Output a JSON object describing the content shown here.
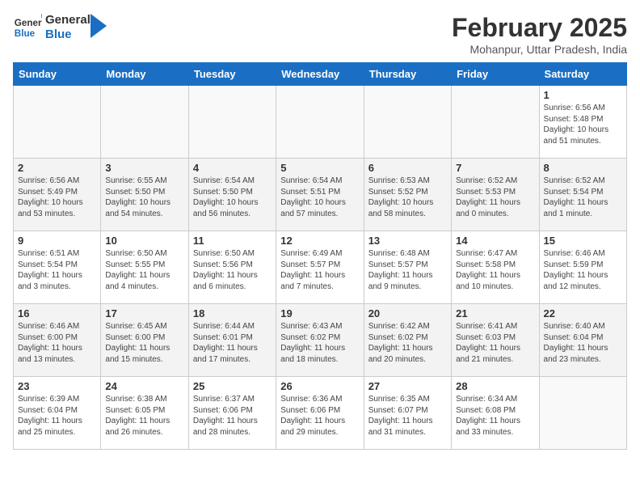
{
  "app": {
    "name": "GeneralBlue",
    "logo_text_general": "General",
    "logo_text_blue": "Blue"
  },
  "title": "February 2025",
  "location": "Mohanpur, Uttar Pradesh, India",
  "weekdays": [
    "Sunday",
    "Monday",
    "Tuesday",
    "Wednesday",
    "Thursday",
    "Friday",
    "Saturday"
  ],
  "weeks": [
    [
      {
        "day": "",
        "info": ""
      },
      {
        "day": "",
        "info": ""
      },
      {
        "day": "",
        "info": ""
      },
      {
        "day": "",
        "info": ""
      },
      {
        "day": "",
        "info": ""
      },
      {
        "day": "",
        "info": ""
      },
      {
        "day": "1",
        "info": "Sunrise: 6:56 AM\nSunset: 5:48 PM\nDaylight: 10 hours\nand 51 minutes."
      }
    ],
    [
      {
        "day": "2",
        "info": "Sunrise: 6:56 AM\nSunset: 5:49 PM\nDaylight: 10 hours\nand 53 minutes."
      },
      {
        "day": "3",
        "info": "Sunrise: 6:55 AM\nSunset: 5:50 PM\nDaylight: 10 hours\nand 54 minutes."
      },
      {
        "day": "4",
        "info": "Sunrise: 6:54 AM\nSunset: 5:50 PM\nDaylight: 10 hours\nand 56 minutes."
      },
      {
        "day": "5",
        "info": "Sunrise: 6:54 AM\nSunset: 5:51 PM\nDaylight: 10 hours\nand 57 minutes."
      },
      {
        "day": "6",
        "info": "Sunrise: 6:53 AM\nSunset: 5:52 PM\nDaylight: 10 hours\nand 58 minutes."
      },
      {
        "day": "7",
        "info": "Sunrise: 6:52 AM\nSunset: 5:53 PM\nDaylight: 11 hours\nand 0 minutes."
      },
      {
        "day": "8",
        "info": "Sunrise: 6:52 AM\nSunset: 5:54 PM\nDaylight: 11 hours\nand 1 minute."
      }
    ],
    [
      {
        "day": "9",
        "info": "Sunrise: 6:51 AM\nSunset: 5:54 PM\nDaylight: 11 hours\nand 3 minutes."
      },
      {
        "day": "10",
        "info": "Sunrise: 6:50 AM\nSunset: 5:55 PM\nDaylight: 11 hours\nand 4 minutes."
      },
      {
        "day": "11",
        "info": "Sunrise: 6:50 AM\nSunset: 5:56 PM\nDaylight: 11 hours\nand 6 minutes."
      },
      {
        "day": "12",
        "info": "Sunrise: 6:49 AM\nSunset: 5:57 PM\nDaylight: 11 hours\nand 7 minutes."
      },
      {
        "day": "13",
        "info": "Sunrise: 6:48 AM\nSunset: 5:57 PM\nDaylight: 11 hours\nand 9 minutes."
      },
      {
        "day": "14",
        "info": "Sunrise: 6:47 AM\nSunset: 5:58 PM\nDaylight: 11 hours\nand 10 minutes."
      },
      {
        "day": "15",
        "info": "Sunrise: 6:46 AM\nSunset: 5:59 PM\nDaylight: 11 hours\nand 12 minutes."
      }
    ],
    [
      {
        "day": "16",
        "info": "Sunrise: 6:46 AM\nSunset: 6:00 PM\nDaylight: 11 hours\nand 13 minutes."
      },
      {
        "day": "17",
        "info": "Sunrise: 6:45 AM\nSunset: 6:00 PM\nDaylight: 11 hours\nand 15 minutes."
      },
      {
        "day": "18",
        "info": "Sunrise: 6:44 AM\nSunset: 6:01 PM\nDaylight: 11 hours\nand 17 minutes."
      },
      {
        "day": "19",
        "info": "Sunrise: 6:43 AM\nSunset: 6:02 PM\nDaylight: 11 hours\nand 18 minutes."
      },
      {
        "day": "20",
        "info": "Sunrise: 6:42 AM\nSunset: 6:02 PM\nDaylight: 11 hours\nand 20 minutes."
      },
      {
        "day": "21",
        "info": "Sunrise: 6:41 AM\nSunset: 6:03 PM\nDaylight: 11 hours\nand 21 minutes."
      },
      {
        "day": "22",
        "info": "Sunrise: 6:40 AM\nSunset: 6:04 PM\nDaylight: 11 hours\nand 23 minutes."
      }
    ],
    [
      {
        "day": "23",
        "info": "Sunrise: 6:39 AM\nSunset: 6:04 PM\nDaylight: 11 hours\nand 25 minutes."
      },
      {
        "day": "24",
        "info": "Sunrise: 6:38 AM\nSunset: 6:05 PM\nDaylight: 11 hours\nand 26 minutes."
      },
      {
        "day": "25",
        "info": "Sunrise: 6:37 AM\nSunset: 6:06 PM\nDaylight: 11 hours\nand 28 minutes."
      },
      {
        "day": "26",
        "info": "Sunrise: 6:36 AM\nSunset: 6:06 PM\nDaylight: 11 hours\nand 29 minutes."
      },
      {
        "day": "27",
        "info": "Sunrise: 6:35 AM\nSunset: 6:07 PM\nDaylight: 11 hours\nand 31 minutes."
      },
      {
        "day": "28",
        "info": "Sunrise: 6:34 AM\nSunset: 6:08 PM\nDaylight: 11 hours\nand 33 minutes."
      },
      {
        "day": "",
        "info": ""
      }
    ]
  ]
}
